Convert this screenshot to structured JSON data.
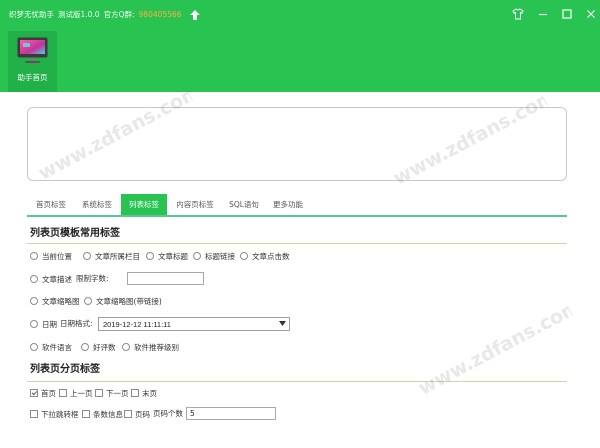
{
  "window": {
    "title": "织梦无忧助手",
    "version": "测试版1.0.0",
    "qq_label": "官方Q群:",
    "qq_number": "980405566",
    "icons": {
      "update": "arrow-up-icon",
      "skin": "shirt-icon",
      "minimize": "minimize-icon",
      "maximize": "maximize-icon",
      "close": "close-icon"
    }
  },
  "colors": {
    "header_green": "#29c352",
    "nav_active": "#22b048",
    "qq_number": "#ffae42",
    "tab_active": "#29c352",
    "tab_line": "#5cc596",
    "heading_rule": "#d9cfa6"
  },
  "nav": {
    "items": [
      {
        "label": "助手首页",
        "icon": "monitor-icon",
        "active": true
      }
    ]
  },
  "output": {
    "value": ""
  },
  "tabs": [
    {
      "label": "首页标签",
      "active": false
    },
    {
      "label": "系统标签",
      "active": false
    },
    {
      "label": "列表标签",
      "active": true
    },
    {
      "label": "内容页标签",
      "active": false
    },
    {
      "label": "SQL语句",
      "active": false
    },
    {
      "label": "更多功能",
      "active": false
    }
  ],
  "list_tags": {
    "heading": "列表页模板常用标签",
    "options": [
      {
        "label": "当前位置",
        "selected": false
      },
      {
        "label": "文章所属栏目",
        "selected": false
      },
      {
        "label": "文章标题",
        "selected": false
      },
      {
        "label": "标题链接",
        "selected": false
      },
      {
        "label": "文章点击数",
        "selected": false
      },
      {
        "label": "文章描述",
        "selected": false
      },
      {
        "label": "文章缩略图",
        "selected": false
      },
      {
        "label": "文章缩略图(带链接)",
        "selected": false
      },
      {
        "label": "日期",
        "selected": false
      },
      {
        "label": "软件语言",
        "selected": false
      },
      {
        "label": "好评数",
        "selected": false
      },
      {
        "label": "软件推荐级别",
        "selected": false
      }
    ],
    "char_limit": {
      "label": "限制字数:",
      "value": ""
    },
    "date_format": {
      "label": "日期格式:",
      "value": "2019-12-12 11:11:11",
      "icon": "chevron-down-icon"
    }
  },
  "pagination_tags": {
    "heading": "列表页分页标签",
    "options": [
      {
        "label": "首页",
        "checked": true
      },
      {
        "label": "上一页",
        "checked": false
      },
      {
        "label": "下一页",
        "checked": false
      },
      {
        "label": "末页",
        "checked": false
      },
      {
        "label": "下拉跳转框",
        "checked": false
      },
      {
        "label": "条数信息",
        "checked": false
      },
      {
        "label": "页码",
        "checked": false
      }
    ],
    "page_count": {
      "label": "页码个数",
      "value": "5"
    }
  },
  "watermark": {
    "text": "www.zdfans.com"
  }
}
